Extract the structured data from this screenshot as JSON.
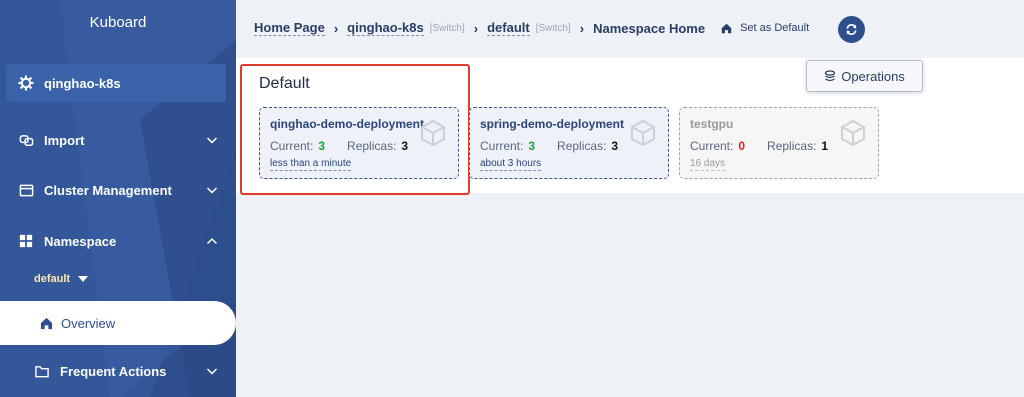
{
  "app": {
    "brand": "Kuboard"
  },
  "sidebar": {
    "cluster": "qinghao-k8s",
    "items": [
      {
        "label": "Import",
        "icon": "link-icon",
        "expanded": false
      },
      {
        "label": "Cluster Management",
        "icon": "cluster-icon",
        "expanded": false
      },
      {
        "label": "Namespace",
        "icon": "grid-icon",
        "expanded": true
      },
      {
        "label": "Frequent Actions",
        "icon": "folder-icon",
        "expanded": false
      }
    ],
    "namespace_select": "default",
    "overview": "Overview"
  },
  "breadcrumb": {
    "home": "Home Page",
    "cluster": "qinghao-k8s",
    "cluster_switch": "[Switch]",
    "namespace": "default",
    "namespace_switch": "[Switch]",
    "current": "Namespace Home",
    "set_default": "Set as Default"
  },
  "toolbar": {
    "operations": "Operations"
  },
  "section": {
    "title": "Default"
  },
  "stat_labels": {
    "current": "Current:",
    "replicas": "Replicas:"
  },
  "deployments": [
    {
      "name": "qinghao-demo-deployment",
      "current": "3",
      "replicas": "3",
      "age": "less than a minute",
      "current_color": "#19a632"
    },
    {
      "name": "spring-demo-deployment",
      "current": "3",
      "replicas": "3",
      "age": "about 3 hours",
      "current_color": "#19a632"
    },
    {
      "name": "testgpu",
      "current": "0",
      "replicas": "1",
      "age": "16 days",
      "current_color": "#e02020"
    }
  ],
  "colors": {
    "sidebar": "#2e4e8e",
    "accent": "#2e4e8e",
    "highlight": "#e23a2e"
  }
}
